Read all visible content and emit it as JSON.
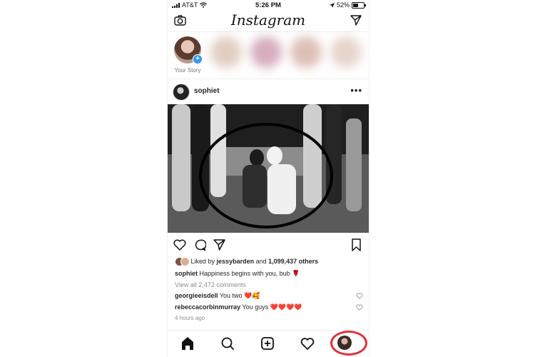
{
  "status_bar": {
    "carrier": "AT&T",
    "time": "5:26 PM",
    "battery": "52%",
    "battery_level": 0.52
  },
  "header": {
    "logo": "Instagram",
    "camera_icon": "camera-icon",
    "direct_icon": "paper-plane-icon"
  },
  "stories": {
    "your_story_label": "Your Story",
    "blurred_colors": [
      "#c8a68f",
      "#b56a8a",
      "#c18a7a",
      "#d4b3a3"
    ]
  },
  "post": {
    "username": "sophiet",
    "more_icon": "more-dots-icon",
    "liked_by_prefix": "Liked by ",
    "liked_by_user": "jessybarden",
    "liked_by_suffix": " and ",
    "others": "1,099,437 others",
    "caption_user": "sophiet",
    "caption_text": " Happiness begins with you, bub 🌹",
    "view_comments": "View all 2,472 comments",
    "comments": [
      {
        "user": "georgieeisdell",
        "text": " You two ❤️🥰"
      },
      {
        "user": "rebeccacorbinmurray",
        "text": " You guys ❤️❤️❤️❤️"
      }
    ],
    "time_ago": "4 hours ago"
  },
  "bottom_nav": {
    "items": [
      "home-icon",
      "search-icon",
      "add-post-icon",
      "activity-heart-icon",
      "profile-avatar"
    ]
  },
  "colors": {
    "accent_blue": "#3897f0",
    "highlight_red": "#e2303a"
  }
}
